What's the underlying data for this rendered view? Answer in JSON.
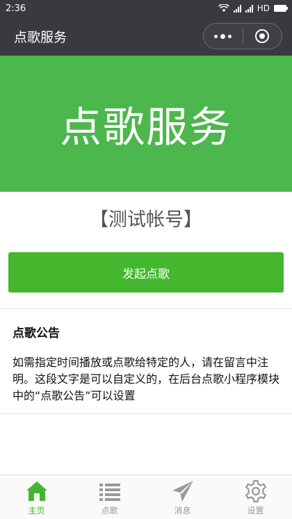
{
  "status_bar": {
    "time": "2:36",
    "network": "HD"
  },
  "nav": {
    "title": "点歌服务"
  },
  "banner": {
    "title": "点歌服务"
  },
  "account": {
    "label": "【测试帐号】"
  },
  "action": {
    "button_label": "发起点歌"
  },
  "notice": {
    "title": "点歌公告",
    "text": "如需指定时间播放或点歌给特定的人，请在留言中注明。这段文字是可以自定义的，在后台点歌小程序模块中的“点歌公告”可以设置"
  },
  "tabs": [
    {
      "label": "主页",
      "icon": "home-icon",
      "active": true
    },
    {
      "label": "点歌",
      "icon": "list-icon",
      "active": false
    },
    {
      "label": "消息",
      "icon": "paper-plane-icon",
      "active": false
    },
    {
      "label": "设置",
      "icon": "gear-icon",
      "active": false
    }
  ],
  "colors": {
    "accent": "#44b72e",
    "banner": "#4cb74c",
    "nav": "#393a3f",
    "inactive": "#999999"
  }
}
